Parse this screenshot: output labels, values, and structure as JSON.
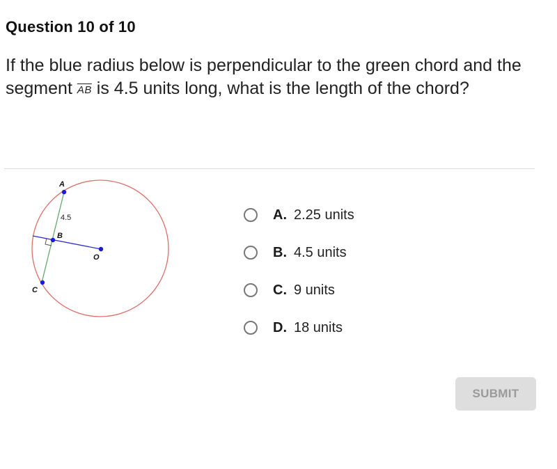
{
  "header": {
    "title": "Question 10 of 10"
  },
  "question": {
    "text_before": "If the blue radius below is perpendicular to the green chord and the segment ",
    "segment_label": "AB",
    "text_after": " is 4.5 units long, what is the length of the chord?"
  },
  "diagram": {
    "points": {
      "A": "A",
      "B": "B",
      "C": "C",
      "O": "O"
    },
    "segment_length_label": "4.5",
    "colors": {
      "circle": "#d9534f",
      "chord": "#6aa86a",
      "radius": "#2b2bd6",
      "point": "#1a1ad8"
    }
  },
  "choices": [
    {
      "letter": "A.",
      "text": "2.25 units"
    },
    {
      "letter": "B.",
      "text": "4.5 units"
    },
    {
      "letter": "C.",
      "text": "9 units"
    },
    {
      "letter": "D.",
      "text": "18 units"
    }
  ],
  "submit": {
    "label": "SUBMIT",
    "enabled": false
  }
}
